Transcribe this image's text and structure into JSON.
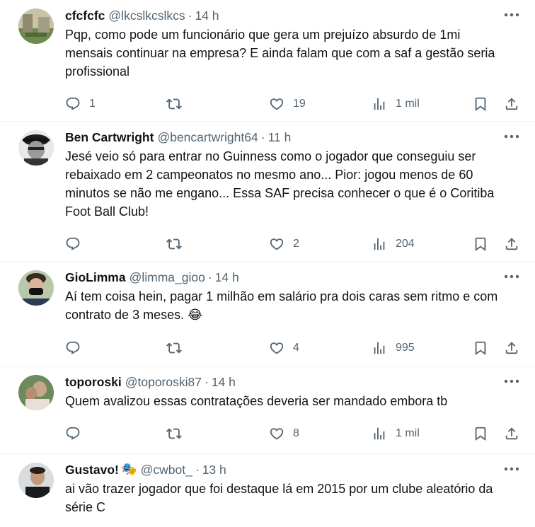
{
  "tweets": [
    {
      "name": "cfcfcfc",
      "handle": "@lkcslkcslkcs",
      "time": "14 h",
      "text": "Pqp, como pode um funcionário que gera um prejuízo absurdo de 1mi mensais continuar na empresa? E ainda falam que com a saf a gestão seria profissional",
      "replies": "1",
      "retweets": "",
      "likes": "19",
      "views": "1 mil"
    },
    {
      "name": "Ben Cartwright",
      "handle": "@bencartwright64",
      "time": "11 h",
      "text": "Jesé veio só para entrar no Guinness como o jogador que conseguiu ser rebaixado em 2 campeonatos no mesmo ano... Pior: jogou menos de 60 minutos se não me engano... Essa SAF precisa conhecer o que é o Coritiba Foot Ball Club!",
      "replies": "",
      "retweets": "",
      "likes": "2",
      "views": "204"
    },
    {
      "name": "GioLimma",
      "handle": "@limma_gioo",
      "time": "14 h",
      "text": "Aí tem coisa hein, pagar 1 milhão em salário pra dois caras sem ritmo e com contrato de 3 meses.",
      "emoji": "😂",
      "replies": "",
      "retweets": "",
      "likes": "4",
      "views": "995"
    },
    {
      "name": "toporoski",
      "handle": "@toporoski87",
      "time": "14 h",
      "text": "Quem avalizou essas contratações deveria ser mandado embora tb",
      "replies": "",
      "retweets": "",
      "likes": "8",
      "views": "1 mil"
    },
    {
      "name": "Gustavo!",
      "name_emoji": "🎭",
      "handle": "@cwbot_",
      "time": "13 h",
      "text": "ai vão trazer jogador que foi destaque lá em 2015 por um clube aleatório da série C"
    }
  ],
  "separator": "·",
  "colors": {
    "text": "#0f1419",
    "secondary": "#536471",
    "border": "#eff3f4"
  },
  "icons": [
    "reply-icon",
    "retweet-icon",
    "like-icon",
    "views-icon",
    "bookmark-icon",
    "share-icon",
    "more-icon"
  ]
}
